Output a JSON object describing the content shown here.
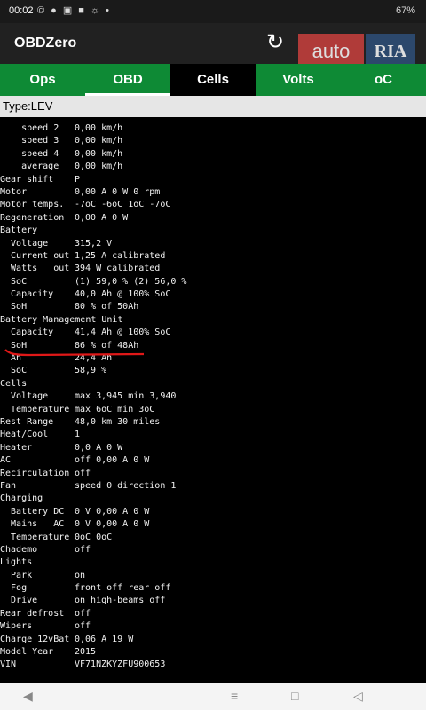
{
  "status": {
    "time": "00:02",
    "icons": "© ● ▣ ■ ☼ •",
    "battery": "67%"
  },
  "appbar": {
    "title": "OBDZero"
  },
  "watermark": {
    "auto": "auto",
    "ria": "RIA"
  },
  "tabs": [
    "Ops",
    "OBD",
    "Cells",
    "Volts",
    "oC"
  ],
  "type_label": "Type:LEV",
  "rows": [
    {
      "label": "    speed 2",
      "value": "0,00 km/h"
    },
    {
      "label": "    speed 3",
      "value": "0,00 km/h"
    },
    {
      "label": "    speed 4",
      "value": "0,00 km/h"
    },
    {
      "label": "    average",
      "value": "0,00 km/h"
    },
    {
      "label": "Gear shift",
      "value": "P"
    },
    {
      "label": "Motor",
      "value": "0,00 A 0 W 0 rpm"
    },
    {
      "label": "Motor temps.",
      "value": "-7oC -6oC 1oC -7oC"
    },
    {
      "label": "Regeneration",
      "value": "0,00 A 0 W"
    },
    {
      "label": "Battery",
      "value": ""
    },
    {
      "label": "  Voltage",
      "value": "315,2 V"
    },
    {
      "label": "  Current out",
      "value": "1,25 A calibrated"
    },
    {
      "label": "  Watts   out",
      "value": "394 W calibrated"
    },
    {
      "label": "  SoC",
      "value": "(1) 59,0 % (2) 56,0 %"
    },
    {
      "label": "  Capacity",
      "value": "40,0 Ah @ 100% SoC"
    },
    {
      "label": "  SoH",
      "value": "80 % of 50Ah"
    },
    {
      "label": "Battery Management Unit",
      "value": ""
    },
    {
      "label": "  Capacity",
      "value": "41,4 Ah @ 100% SoC"
    },
    {
      "label": "  SoH",
      "value": "86 % of 48Ah"
    },
    {
      "label": "  Ah",
      "value": "24,4 Ah"
    },
    {
      "label": "  SoC",
      "value": "58,9 %"
    },
    {
      "label": "Cells",
      "value": ""
    },
    {
      "label": "  Voltage",
      "value": "max 3,945 min 3,940"
    },
    {
      "label": "  Temperature",
      "value": "max 6oC min 3oC"
    },
    {
      "label": "Rest Range",
      "value": "48,0 km 30 miles"
    },
    {
      "label": "Heat/Cool",
      "value": "1"
    },
    {
      "label": "Heater",
      "value": "0,0 A 0 W"
    },
    {
      "label": "AC",
      "value": "off 0,00 A 0 W"
    },
    {
      "label": "Recirculation",
      "value": "off"
    },
    {
      "label": "Fan",
      "value": "speed 0 direction 1"
    },
    {
      "label": "Charging",
      "value": ""
    },
    {
      "label": "  Battery DC",
      "value": "0 V 0,00 A 0 W"
    },
    {
      "label": "  Mains   AC",
      "value": "0 V 0,00 A 0 W"
    },
    {
      "label": "  Temperature",
      "value": "0oC 0oC"
    },
    {
      "label": "Chademo",
      "value": "off"
    },
    {
      "label": "Lights",
      "value": ""
    },
    {
      "label": "  Park",
      "value": "on"
    },
    {
      "label": "  Fog",
      "value": "front off rear off"
    },
    {
      "label": "  Drive",
      "value": "on high-beams off"
    },
    {
      "label": "Rear defrost",
      "value": "off"
    },
    {
      "label": "Wipers",
      "value": "off"
    },
    {
      "label": "Charge 12vBat",
      "value": "0,06 A 19 W"
    },
    {
      "label": "Model Year",
      "value": "2015"
    },
    {
      "label": "VIN",
      "value": "VF71NZKYZFU900653"
    }
  ],
  "colors": {
    "tab_green": "#0e8a35",
    "annotation_red": "#e01818"
  }
}
